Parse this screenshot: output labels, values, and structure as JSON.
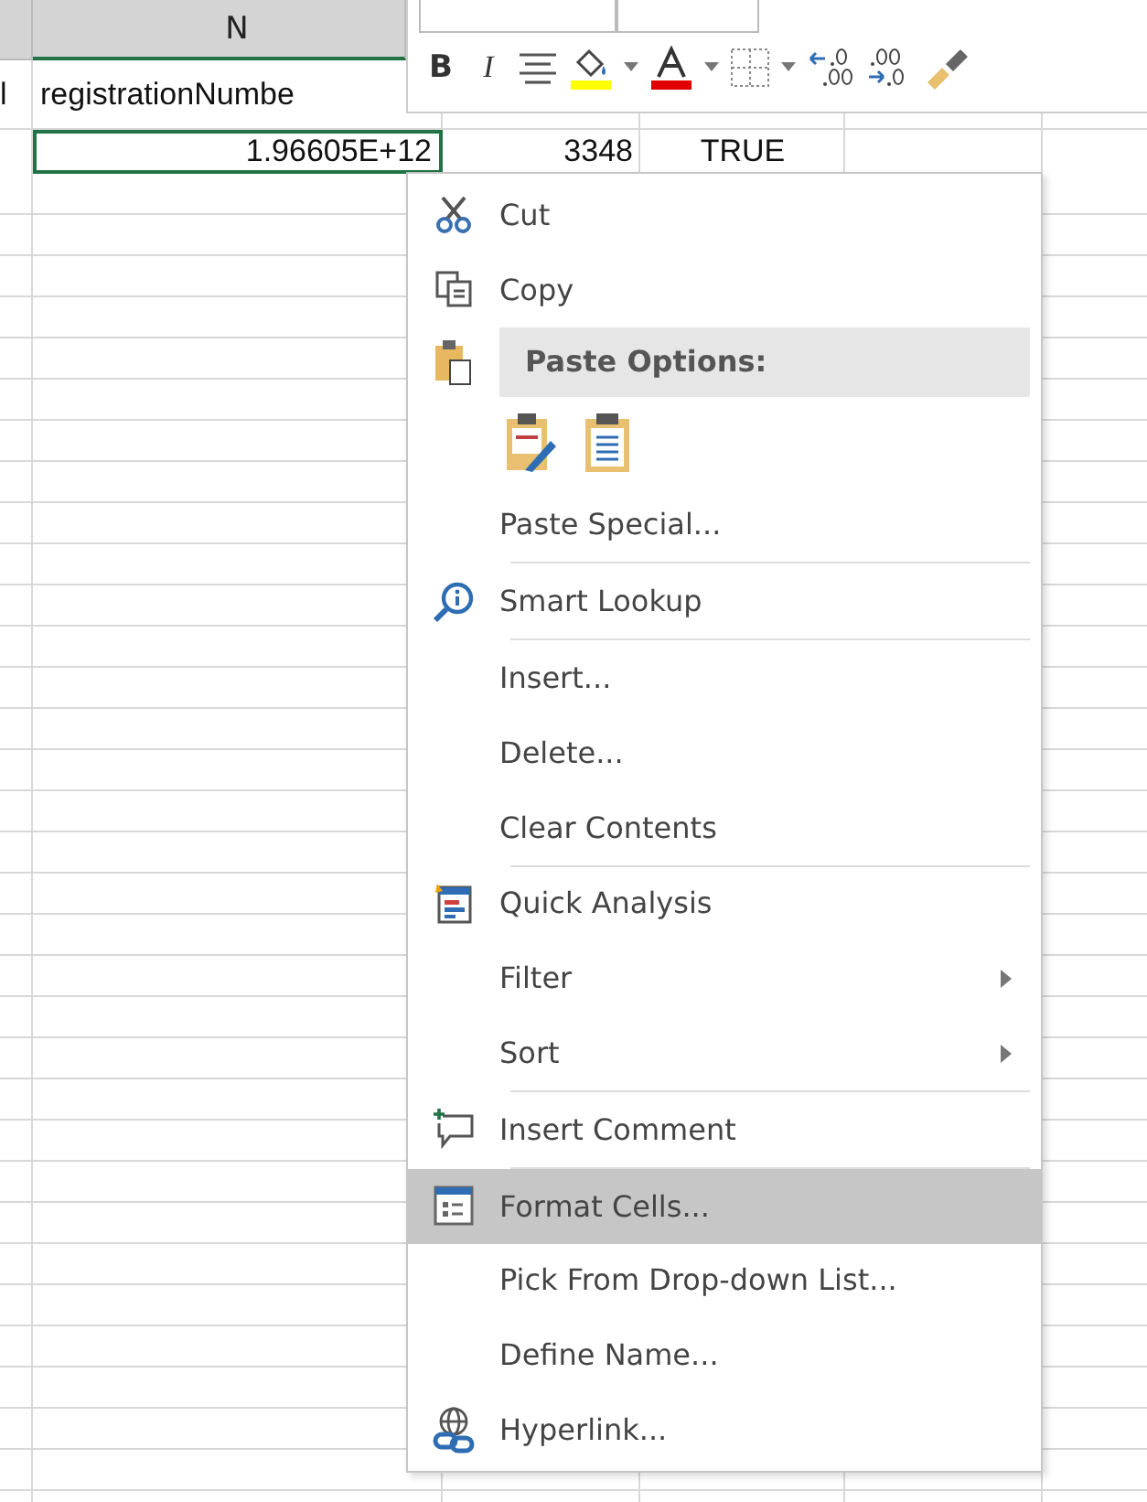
{
  "sheet": {
    "column_header": "N",
    "rows": [
      {
        "cells": [
          "l",
          "registrationNumbe",
          "",
          "",
          ""
        ],
        "selected": false
      },
      {
        "cells": [
          "",
          "1.96605E+12",
          "3348",
          "TRUE",
          ""
        ],
        "selected": true
      }
    ]
  },
  "mini_toolbar": {
    "buttons": [
      {
        "kind": "bold",
        "label": "B"
      },
      {
        "kind": "italic",
        "label": "I"
      },
      {
        "kind": "align"
      },
      {
        "kind": "fill",
        "color": "#ffff00"
      },
      {
        "kind": "font-color",
        "color": "#e00000"
      },
      {
        "kind": "borders"
      },
      {
        "kind": "increase-decimal"
      },
      {
        "kind": "decrease-decimal"
      },
      {
        "kind": "format-painter"
      }
    ]
  },
  "context_menu": {
    "items": [
      {
        "kind": "cut",
        "label": "Cut",
        "submenu": false,
        "selected": false
      },
      {
        "kind": "copy",
        "label": "Copy",
        "submenu": false,
        "selected": false
      },
      {
        "kind": "header",
        "label": "Paste Options:"
      },
      {
        "kind": "paste-options"
      },
      {
        "kind": "item",
        "label": "Paste Special...",
        "submenu": false,
        "selected": false
      },
      {
        "kind": "separator"
      },
      {
        "kind": "lookup",
        "label": "Smart Lookup",
        "submenu": false,
        "selected": false
      },
      {
        "kind": "separator"
      },
      {
        "kind": "item",
        "label": "Insert...",
        "submenu": false,
        "selected": false
      },
      {
        "kind": "item",
        "label": "Delete...",
        "submenu": false,
        "selected": false
      },
      {
        "kind": "item",
        "label": "Clear Contents",
        "submenu": false,
        "selected": false
      },
      {
        "kind": "separator"
      },
      {
        "kind": "quick-analysis",
        "label": "Quick Analysis",
        "submenu": false,
        "selected": false
      },
      {
        "kind": "item",
        "label": "Filter",
        "submenu": true,
        "selected": false
      },
      {
        "kind": "item",
        "label": "Sort",
        "submenu": true,
        "selected": false
      },
      {
        "kind": "separator"
      },
      {
        "kind": "comment",
        "label": "Insert Comment",
        "submenu": false,
        "selected": false
      },
      {
        "kind": "separator"
      },
      {
        "kind": "format-cells",
        "label": "Format Cells...",
        "submenu": false,
        "selected": true
      },
      {
        "kind": "item",
        "label": "Pick From Drop-down List...",
        "submenu": false,
        "selected": false
      },
      {
        "kind": "item",
        "label": "Define Name...",
        "submenu": false,
        "selected": false
      },
      {
        "kind": "hyperlink",
        "label": "Hyperlink...",
        "submenu": false,
        "selected": false
      }
    ]
  }
}
